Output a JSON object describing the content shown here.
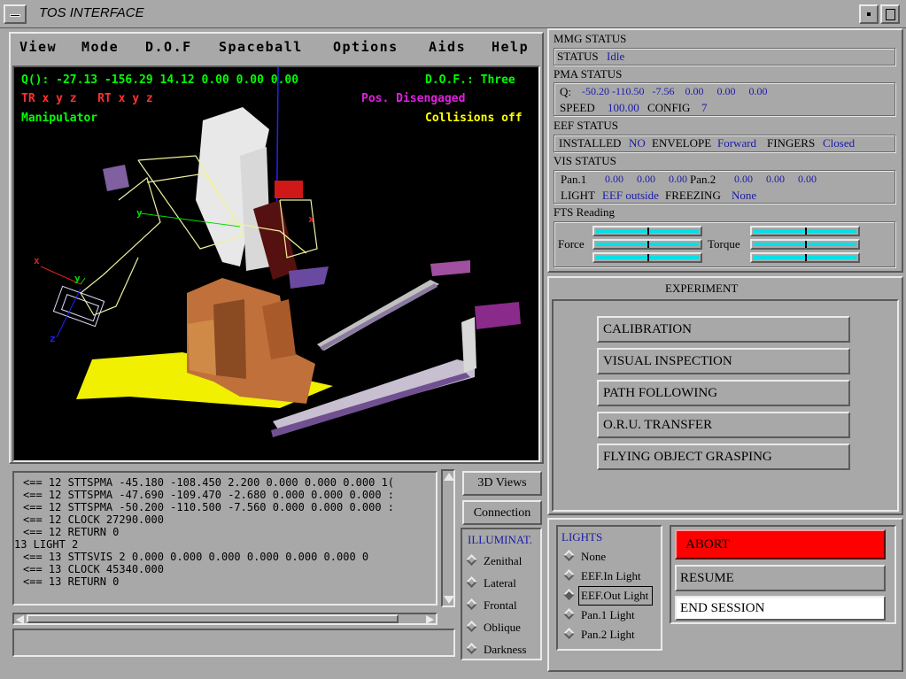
{
  "window": {
    "title": "TOS INTERFACE"
  },
  "menu": [
    "View",
    "Mode",
    "D.O.F",
    "Spaceball",
    "Options",
    "Aids",
    "Help"
  ],
  "scene": {
    "q_readout": "Q(): -27.13 -156.29 14.12 0.00 0.00 0.00",
    "dof": "D.O.F.: Three",
    "frames": "TR x y z   RT x y z",
    "pos": "Pos. Disengaged",
    "mode": "Manipulator",
    "collisions": "Collisions off",
    "axis_x": "x",
    "axis_y": "y",
    "axis_z": "z",
    "axis_x2": "x",
    "axis_y2": "y",
    "axis_z2": "z"
  },
  "log": {
    "lines": [
      "<== 12 STTSPMA -45.180 -108.450 2.200 0.000 0.000 0.000 1(",
      "<== 12 STTSPMA -47.690 -109.470 -2.680 0.000 0.000 0.000 :",
      "<== 12 STTSPMA -50.200 -110.500 -7.560 0.000 0.000 0.000 :",
      "<== 12 CLOCK 27290.000",
      "<== 12 RETURN 0",
      "13 LIGHT 2",
      "<== 13 STTSVIS 2 0.000 0.000 0.000 0.000 0.000 0.000 0",
      "<== 13 CLOCK 45340.000",
      "<== 13 RETURN 0"
    ]
  },
  "side": {
    "views_3d": "3D Views",
    "connection": "Connection"
  },
  "illumination": {
    "title": "ILLUMINAT.",
    "options": [
      "Zenithal",
      "Lateral",
      "Frontal",
      "Oblique",
      "Darkness"
    ]
  },
  "mmg": {
    "title": "MMG STATUS",
    "status_label": "STATUS",
    "status": "Idle"
  },
  "pma": {
    "title": "PMA STATUS",
    "q_label": "Q:",
    "q_values": "-50.20 -110.50   -7.56    0.00     0.00     0.00",
    "speed_label": "SPEED",
    "speed": "100.00",
    "config_label": "CONFIG",
    "config": "7"
  },
  "eef": {
    "title": "EEF STATUS",
    "installed_label": "INSTALLED",
    "installed": "NO",
    "envelope_label": "ENVELOPE",
    "envelope": "Forward",
    "fingers_label": "FINGERS",
    "fingers": "Closed"
  },
  "vis": {
    "title": "VIS STATUS",
    "pan1_label": "Pan.1",
    "pan1": "0.00     0.00     0.00",
    "pan2_label": "Pan.2",
    "pan2": "0.00     0.00     0.00",
    "light_label": "LIGHT",
    "light": "EEF outside",
    "freezing_label": "FREEZING",
    "freezing": "None"
  },
  "fts": {
    "title": "FTS Reading",
    "force_label": "Force",
    "torque_label": "Torque",
    "bar_color": "#00e0e8"
  },
  "experiment": {
    "title": "EXPERIMENT",
    "buttons": [
      "CALIBRATION",
      "VISUAL INSPECTION",
      "PATH FOLLOWING",
      "O.R.U. TRANSFER",
      "FLYING OBJECT GRASPING"
    ]
  },
  "lights": {
    "title": "LIGHTS",
    "options": [
      "None",
      "EEF.In Light",
      "EEF.Out Light",
      "Pan.1 Light",
      "Pan.2 Light"
    ],
    "selected": "EEF.Out Light"
  },
  "session": {
    "abort": "ABORT",
    "resume": "RESUME",
    "end": "END SESSION",
    "abort_color": "#ff0000"
  }
}
